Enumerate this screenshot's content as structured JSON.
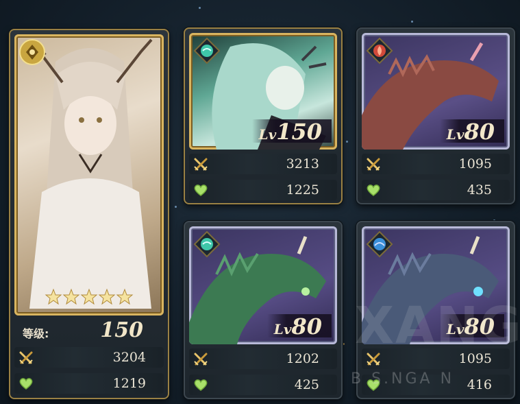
{
  "main_card": {
    "element": "light",
    "rarity_stars": 5,
    "level_label": "等级:",
    "level_value": "150",
    "attack": "3204",
    "hp": "1219"
  },
  "team_cards": [
    {
      "element": "wind",
      "level_prefix": "Lv",
      "level": "150",
      "attack": "3213",
      "hp": "1225",
      "frame": "gold"
    },
    {
      "element": "fire",
      "level_prefix": "Lv",
      "level": "80",
      "attack": "1095",
      "hp": "435",
      "frame": "silver"
    },
    {
      "element": "wind",
      "level_prefix": "Lv",
      "level": "80",
      "attack": "1202",
      "hp": "425",
      "frame": "silver"
    },
    {
      "element": "water",
      "level_prefix": "Lv",
      "level": "80",
      "attack": "1095",
      "hp": "416",
      "frame": "silver"
    }
  ],
  "watermark": {
    "big": "XANGA",
    "small": "B S.NGA N"
  },
  "icons": {
    "attack": "crossed-swords-icon",
    "hp": "heart-icon"
  },
  "colors": {
    "gold_frame": "#d9b560",
    "silver_frame": "#b8b9d8",
    "stat_text": "#ece6d6"
  }
}
